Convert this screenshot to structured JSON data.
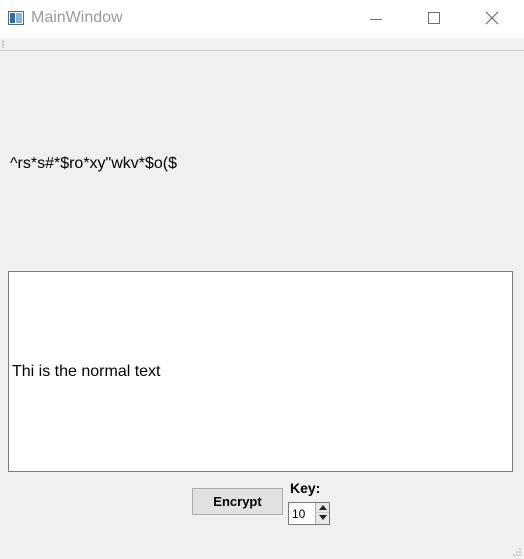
{
  "window": {
    "title": "MainWindow",
    "icon": "app-window-icon",
    "controls": [
      "minimize-icon",
      "maximize-icon",
      "close-icon"
    ]
  },
  "main": {
    "encrypted_text": "^rs*s#*$ro*xy\"wkv*$o($",
    "input_text": "Thi is the normal text",
    "encrypt_button_label": "Encrypt",
    "key_label": "Key:",
    "key_value": "10"
  },
  "colors": {
    "window_bg": "#f0f0f0",
    "titlebar_bg": "#ffffff",
    "title_text": "#9a9a9a"
  }
}
